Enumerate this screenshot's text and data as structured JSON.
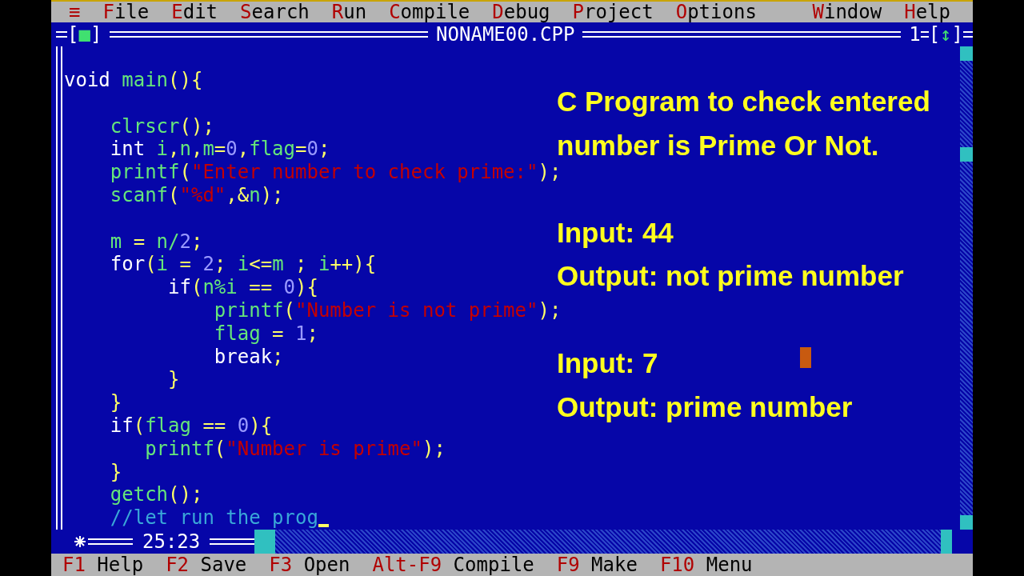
{
  "menu": {
    "system": "≡",
    "left": [
      "File",
      "Edit",
      "Search",
      "Run",
      "Compile",
      "Debug",
      "Project",
      "Options"
    ],
    "right": [
      "Window",
      "Help"
    ]
  },
  "window": {
    "close_button": "[■]",
    "title": "NONAME00.CPP",
    "number": "1",
    "zoom_button": "[↕]",
    "position": "25:23"
  },
  "code": [
    {
      "kind": "code",
      "cursor": false,
      "tokens": [
        {
          "kind": "kw",
          "text": "void "
        },
        {
          "kind": "id",
          "text": "main"
        },
        {
          "kind": "sym",
          "text": "(){"
        }
      ]
    },
    {
      "kind": "blank"
    },
    {
      "kind": "code",
      "cursor": false,
      "tokens": [
        {
          "kind": "id",
          "text": "    clrscr"
        },
        {
          "kind": "sym",
          "text": "();"
        }
      ]
    },
    {
      "kind": "code",
      "cursor": false,
      "tokens": [
        {
          "kind": "kw",
          "text": "    int "
        },
        {
          "kind": "id",
          "text": "i"
        },
        {
          "kind": "sym",
          "text": ","
        },
        {
          "kind": "id",
          "text": "n"
        },
        {
          "kind": "sym",
          "text": ","
        },
        {
          "kind": "id",
          "text": "m"
        },
        {
          "kind": "sym",
          "text": "="
        },
        {
          "kind": "num",
          "text": "0"
        },
        {
          "kind": "sym",
          "text": ","
        },
        {
          "kind": "id",
          "text": "flag"
        },
        {
          "kind": "sym",
          "text": "="
        },
        {
          "kind": "num",
          "text": "0"
        },
        {
          "kind": "sym",
          "text": ";"
        }
      ]
    },
    {
      "kind": "code",
      "cursor": false,
      "tokens": [
        {
          "kind": "id",
          "text": "    printf"
        },
        {
          "kind": "sym",
          "text": "("
        },
        {
          "kind": "str",
          "text": "\"Enter number to check prime:\""
        },
        {
          "kind": "sym",
          "text": ");"
        }
      ]
    },
    {
      "kind": "code",
      "cursor": false,
      "tokens": [
        {
          "kind": "id",
          "text": "    scanf"
        },
        {
          "kind": "sym",
          "text": "("
        },
        {
          "kind": "str",
          "text": "\"%d\""
        },
        {
          "kind": "sym",
          "text": ",&"
        },
        {
          "kind": "id",
          "text": "n"
        },
        {
          "kind": "sym",
          "text": ");"
        }
      ]
    },
    {
      "kind": "blank"
    },
    {
      "kind": "code",
      "cursor": false,
      "tokens": [
        {
          "kind": "id",
          "text": "    m"
        },
        {
          "kind": "sym",
          "text": " = "
        },
        {
          "kind": "id",
          "text": "n/"
        },
        {
          "kind": "num",
          "text": "2"
        },
        {
          "kind": "sym",
          "text": ";"
        }
      ]
    },
    {
      "kind": "code",
      "cursor": false,
      "tokens": [
        {
          "kind": "kw",
          "text": "    for"
        },
        {
          "kind": "sym",
          "text": "("
        },
        {
          "kind": "id",
          "text": "i"
        },
        {
          "kind": "sym",
          "text": " = "
        },
        {
          "kind": "num",
          "text": "2"
        },
        {
          "kind": "sym",
          "text": "; "
        },
        {
          "kind": "id",
          "text": "i"
        },
        {
          "kind": "sym",
          "text": "<="
        },
        {
          "kind": "id",
          "text": "m"
        },
        {
          "kind": "sym",
          "text": " ; "
        },
        {
          "kind": "id",
          "text": "i"
        },
        {
          "kind": "sym",
          "text": "++){"
        }
      ]
    },
    {
      "kind": "code",
      "cursor": false,
      "tokens": [
        {
          "kind": "kw",
          "text": "         if"
        },
        {
          "kind": "sym",
          "text": "("
        },
        {
          "kind": "id",
          "text": "n%i"
        },
        {
          "kind": "sym",
          "text": " == "
        },
        {
          "kind": "num",
          "text": "0"
        },
        {
          "kind": "sym",
          "text": "){"
        }
      ]
    },
    {
      "kind": "code",
      "cursor": false,
      "tokens": [
        {
          "kind": "id",
          "text": "             printf"
        },
        {
          "kind": "sym",
          "text": "("
        },
        {
          "kind": "str",
          "text": "\"Number is not prime\""
        },
        {
          "kind": "sym",
          "text": ");"
        }
      ]
    },
    {
      "kind": "code",
      "cursor": false,
      "tokens": [
        {
          "kind": "id",
          "text": "             flag"
        },
        {
          "kind": "sym",
          "text": " = "
        },
        {
          "kind": "num",
          "text": "1"
        },
        {
          "kind": "sym",
          "text": ";"
        }
      ]
    },
    {
      "kind": "code",
      "cursor": false,
      "tokens": [
        {
          "kind": "kw",
          "text": "             break"
        },
        {
          "kind": "sym",
          "text": ";"
        }
      ]
    },
    {
      "kind": "code",
      "cursor": false,
      "tokens": [
        {
          "kind": "sym",
          "text": "         }"
        }
      ]
    },
    {
      "kind": "code",
      "cursor": false,
      "tokens": [
        {
          "kind": "sym",
          "text": "    }"
        }
      ]
    },
    {
      "kind": "code",
      "cursor": false,
      "tokens": [
        {
          "kind": "kw",
          "text": "    if"
        },
        {
          "kind": "sym",
          "text": "("
        },
        {
          "kind": "id",
          "text": "flag"
        },
        {
          "kind": "sym",
          "text": " == "
        },
        {
          "kind": "num",
          "text": "0"
        },
        {
          "kind": "sym",
          "text": "){"
        }
      ]
    },
    {
      "kind": "code",
      "cursor": false,
      "tokens": [
        {
          "kind": "id",
          "text": "       printf"
        },
        {
          "kind": "sym",
          "text": "("
        },
        {
          "kind": "str",
          "text": "\"Number is prime\""
        },
        {
          "kind": "sym",
          "text": ");"
        }
      ]
    },
    {
      "kind": "code",
      "cursor": false,
      "tokens": [
        {
          "kind": "sym",
          "text": "    }"
        }
      ]
    },
    {
      "kind": "code",
      "cursor": false,
      "tokens": [
        {
          "kind": "id",
          "text": "    getch"
        },
        {
          "kind": "sym",
          "text": "();"
        }
      ]
    },
    {
      "kind": "code",
      "cursor": true,
      "tokens": [
        {
          "kind": "cmt",
          "text": "    //let run the prog"
        }
      ]
    }
  ],
  "caption": [
    [
      "C Program to check entered",
      "number is Prime Or Not."
    ],
    [
      "Input: 44",
      "Output: not prime number"
    ],
    [
      "Input: 7",
      "Output: prime number"
    ]
  ],
  "function_keys": [
    {
      "key": "F1",
      "label": "Help"
    },
    {
      "key": "F2",
      "label": "Save"
    },
    {
      "key": "F3",
      "label": "Open"
    },
    {
      "key": "Alt-F9",
      "label": "Compile"
    },
    {
      "key": "F9",
      "label": "Make"
    },
    {
      "key": "F10",
      "label": "Menu"
    }
  ]
}
